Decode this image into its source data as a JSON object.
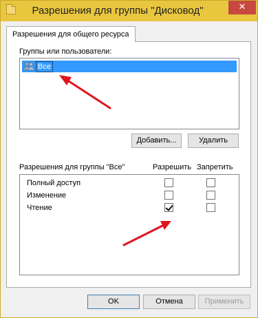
{
  "window": {
    "title": "Разрешения для группы \"Дисковод\"",
    "close_glyph": "✕"
  },
  "tabs": [
    {
      "label": "Разрешения для общего ресурса",
      "active": true
    }
  ],
  "groups": {
    "label": "Группы или пользователи:",
    "items": [
      {
        "label": "Все",
        "icon": "users-icon",
        "selected": true
      }
    ]
  },
  "buttons": {
    "add": "Добавить...",
    "remove": "Удалить",
    "ok": "OK",
    "cancel": "Отмена",
    "apply": "Применить"
  },
  "permissions": {
    "header": "Разрешения для группы \"Все\"",
    "allow_header": "Разрешить",
    "deny_header": "Запретить",
    "rows": [
      {
        "label": "Полный доступ",
        "allow": false,
        "deny": false
      },
      {
        "label": "Изменение",
        "allow": false,
        "deny": false
      },
      {
        "label": "Чтение",
        "allow": true,
        "deny": false
      }
    ]
  },
  "colors": {
    "titlebar": "#e8c63e",
    "selection": "#3399ff",
    "annotation_arrow": "#e0141e",
    "close_button": "#c7483e"
  }
}
